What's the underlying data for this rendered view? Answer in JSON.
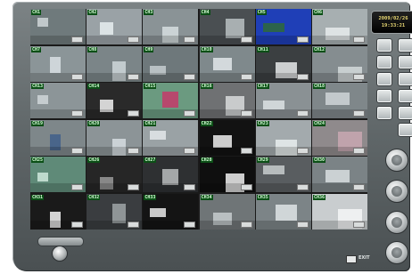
{
  "clock": {
    "date": "2009/02/26",
    "time": "19:33:21"
  },
  "bottom": {
    "exit_label": "EXIT"
  },
  "icons": {
    "view_buttons": [
      "layout-1-icon",
      "layout-4-icon",
      "layout-9-icon",
      "layout-16-icon",
      "layout-25-icon",
      "layout-36-icon",
      "sequence-icon",
      "fullscreen-icon",
      "record-icon",
      "playback-icon",
      "settings-icon",
      "search-icon"
    ],
    "round_buttons": [
      "ptz-icon",
      "audio-icon",
      "snapshot-icon",
      "power-icon"
    ]
  },
  "cameras": [
    {
      "label": "CH1",
      "bg": "#6f7a7c",
      "fg": "#cfd6d8"
    },
    {
      "label": "CH2",
      "bg": "#9aa2a6",
      "fg": "#e8eef0"
    },
    {
      "label": "CH3",
      "bg": "#8a9396",
      "fg": "#d6dee0"
    },
    {
      "label": "CH4",
      "bg": "#4a4f52",
      "fg": "#b8bfc2"
    },
    {
      "label": "CH5",
      "bg": "#1f3fb7",
      "fg": "#2f6a3a"
    },
    {
      "label": "CH6",
      "bg": "#a7afb1",
      "fg": "#e7eced"
    },
    {
      "label": "CH7",
      "bg": "#8b9598",
      "fg": "#d9e1e4"
    },
    {
      "label": "CH8",
      "bg": "#7b8588",
      "fg": "#cfd7da"
    },
    {
      "label": "CH9",
      "bg": "#6e787b",
      "fg": "#c5cdd0"
    },
    {
      "label": "CH10",
      "bg": "#7f898c",
      "fg": "#e2e8ea"
    },
    {
      "label": "CH11",
      "bg": "#3b3f41",
      "fg": "#e6e9ea"
    },
    {
      "label": "CH12",
      "bg": "#858d90",
      "fg": "#d4dadc"
    },
    {
      "label": "CH13",
      "bg": "#8c9598",
      "fg": "#cfd6d8"
    },
    {
      "label": "CH14",
      "bg": "#2a2a2a",
      "fg": "#f2f2f2"
    },
    {
      "label": "CH15",
      "bg": "#6b9a80",
      "fg": "#c43a6a"
    },
    {
      "label": "CH16",
      "bg": "#6f7173",
      "fg": "#d9dbdc"
    },
    {
      "label": "CH17",
      "bg": "#8a9194",
      "fg": "#dce2e4"
    },
    {
      "label": "CH18",
      "bg": "#7f878a",
      "fg": "#cfd5d7"
    },
    {
      "label": "CH19",
      "bg": "#7e878a",
      "fg": "#3f5f8a"
    },
    {
      "label": "CH20",
      "bg": "#8c9497",
      "fg": "#d6dde0"
    },
    {
      "label": "CH21",
      "bg": "#9aa2a5",
      "fg": "#e3e8ea"
    },
    {
      "label": "CH22",
      "bg": "#121212",
      "fg": "#eeeeee"
    },
    {
      "label": "CH23",
      "bg": "#a3aaad",
      "fg": "#e9eeef"
    },
    {
      "label": "CH24",
      "bg": "#8f8a8c",
      "fg": "#c9a7b2"
    },
    {
      "label": "CH25",
      "bg": "#5f8a78",
      "fg": "#cfe8dc"
    },
    {
      "label": "CH26",
      "bg": "#262626",
      "fg": "#9a9a9a"
    },
    {
      "label": "CH27",
      "bg": "#2e3032",
      "fg": "#b9bcbd"
    },
    {
      "label": "CH28",
      "bg": "#0f0f0f",
      "fg": "#f0f0f0"
    },
    {
      "label": "CH29",
      "bg": "#595d60",
      "fg": "#c8ccce"
    },
    {
      "label": "CH30",
      "bg": "#7b8386",
      "fg": "#d9dfe1"
    },
    {
      "label": "CH31",
      "bg": "#1a1a1a",
      "fg": "#f4f4f4"
    },
    {
      "label": "CH32",
      "bg": "#3a3d40",
      "fg": "#9fa4a7"
    },
    {
      "label": "CH33",
      "bg": "#141414",
      "fg": "#e9e9e9"
    },
    {
      "label": "CH34",
      "bg": "#6f7577",
      "fg": "#c7ccce"
    },
    {
      "label": "CH35",
      "bg": "#7c8487",
      "fg": "#dfe4e6"
    },
    {
      "label": "CH36",
      "bg": "#c9cdcf",
      "fg": "#f5f6f7"
    }
  ]
}
